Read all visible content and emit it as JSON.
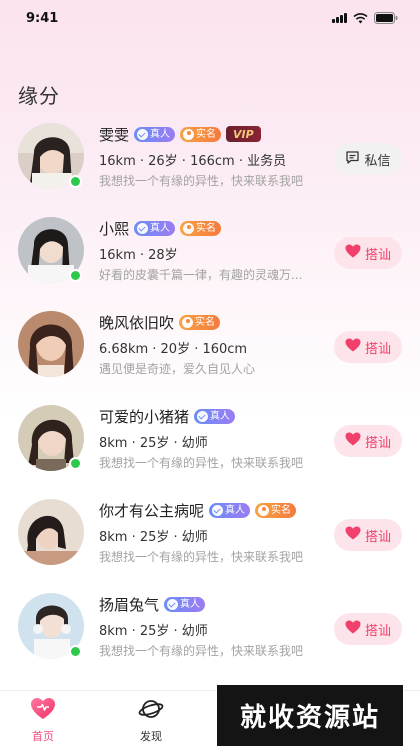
{
  "status_bar": {
    "time": "9:41"
  },
  "page_title": "缘分",
  "users": [
    {
      "name": "雯雯",
      "badges": [
        "real",
        "name",
        "vip"
      ],
      "meta": "16km · 26岁 · 166cm · 业务员",
      "bio": "我想找一个有缘的异性，快来联系我吧",
      "online": true,
      "action": "message",
      "action_label": "私信"
    },
    {
      "name": "小熙",
      "badges": [
        "real",
        "name"
      ],
      "meta": "16km · 28岁",
      "bio": "好看的皮囊千篇一律，有趣的灵魂万...",
      "online": true,
      "action": "greet",
      "action_label": "搭讪"
    },
    {
      "name": "晚风依旧吹",
      "badges": [
        "name"
      ],
      "meta": "6.68km · 20岁 · 160cm",
      "bio": "遇见便是奇迹，爱久自见人心",
      "online": false,
      "action": "greet",
      "action_label": "搭讪"
    },
    {
      "name": "可爱的小猪猪",
      "badges": [
        "real"
      ],
      "meta": "8km · 25岁 · 幼师",
      "bio": "我想找一个有缘的异性，快来联系我吧",
      "online": true,
      "action": "greet",
      "action_label": "搭讪"
    },
    {
      "name": "你才有公主病呢",
      "badges": [
        "real",
        "name"
      ],
      "meta": "8km · 25岁 · 幼师",
      "bio": "我想找一个有缘的异性，快来联系我吧",
      "online": false,
      "action": "greet",
      "action_label": "搭讪"
    },
    {
      "name": "扬眉兔气",
      "badges": [
        "real"
      ],
      "meta": "8km · 25岁 · 幼师",
      "bio": "我想找一个有缘的异性，快来联系我吧",
      "online": true,
      "action": "greet",
      "action_label": "搭讪"
    }
  ],
  "badge_labels": {
    "real": "真人",
    "name": "实名",
    "vip": "VIP"
  },
  "tabs": [
    {
      "label": "首页",
      "icon": "home-heart-icon",
      "active": true
    },
    {
      "label": "发现",
      "icon": "planet-icon",
      "active": false
    }
  ],
  "watermark": "就收资源站",
  "colors": {
    "accent": "#f24c7a",
    "online": "#2dc94a",
    "greet_bg": "#fde3ea"
  }
}
